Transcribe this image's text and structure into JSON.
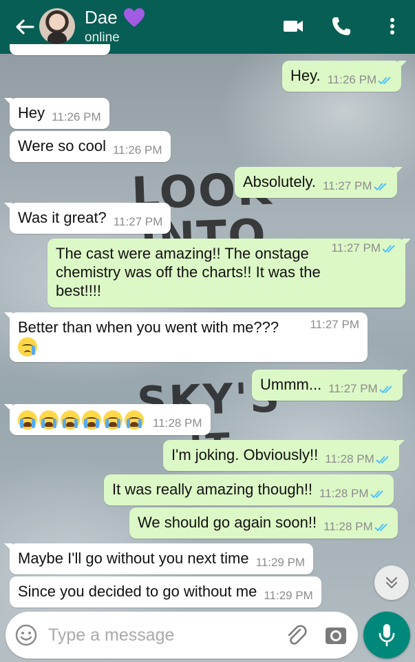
{
  "header": {
    "contact_name": "Dae",
    "status": "online",
    "heart_icon": "purple-heart-icon",
    "color": "#075e54"
  },
  "messages": [
    {
      "dir": "out",
      "text": "Hey.",
      "time": "11:26 PM",
      "read": true
    },
    {
      "dir": "in",
      "text": "Hey",
      "time": "11:26 PM"
    },
    {
      "dir": "in",
      "text": "Were so cool",
      "time": "11:26 PM"
    },
    {
      "dir": "out",
      "text": "Absolutely.",
      "time": "11:27 PM",
      "read": true
    },
    {
      "dir": "in",
      "text": "Was it great?",
      "time": "11:27 PM"
    },
    {
      "dir": "out",
      "text": "The cast were amazing!! The onstage chemistry was off the charts!! It was the best!!!!",
      "time": "11:27 PM",
      "read": true
    },
    {
      "dir": "in",
      "text": "Better than when you went with me???",
      "time": "11:27 PM",
      "emoji": "crying-face"
    },
    {
      "dir": "out",
      "text": "Ummm...",
      "time": "11:27 PM",
      "read": true
    },
    {
      "dir": "in",
      "text": "",
      "time": "11:28 PM",
      "emoji": "loudly-crying-face x6"
    },
    {
      "dir": "out",
      "text": "I'm joking. Obviously!!",
      "time": "11:28 PM",
      "read": true
    },
    {
      "dir": "out",
      "text": "It was really amazing though!!",
      "time": "11:28 PM",
      "read": true
    },
    {
      "dir": "out",
      "text": "We should go again soon!!",
      "time": "11:28 PM",
      "read": true
    },
    {
      "dir": "in",
      "text": "Maybe I'll go without you next time",
      "time": "11:29 PM"
    },
    {
      "dir": "in",
      "text": "Since you decided to go without me",
      "time": "11:29 PM"
    }
  ],
  "input": {
    "placeholder": "Type a message"
  },
  "colors": {
    "outgoing_bubble": "#dcf8c6",
    "incoming_bubble": "#ffffff",
    "read_ticks": "#4fc3f7",
    "mic_button": "#00897b"
  }
}
